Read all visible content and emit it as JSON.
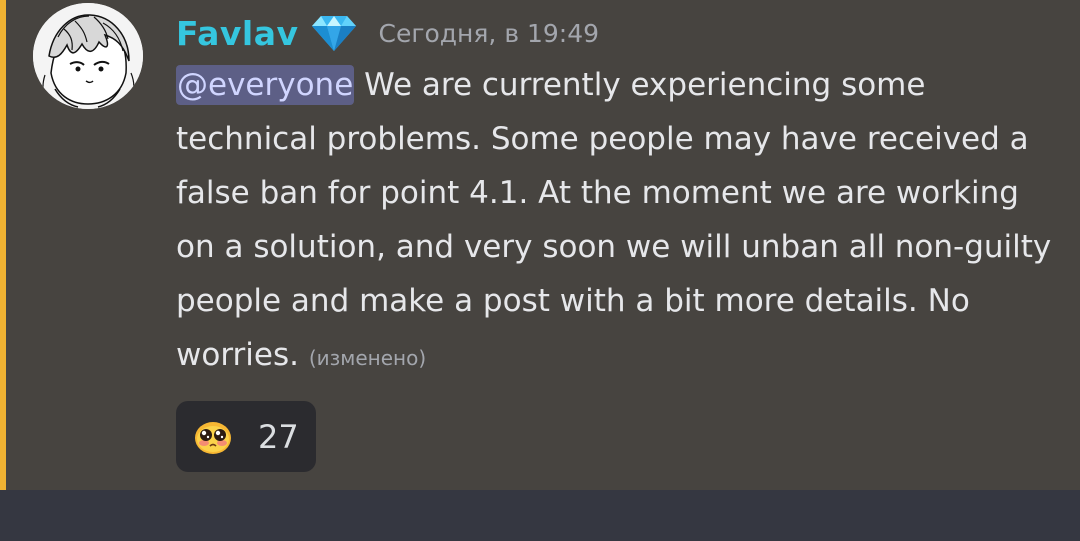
{
  "message": {
    "username": "Favlav",
    "badge_icon": "diamond-icon",
    "timestamp": "Сегодня, в 19:49",
    "mention": "@everyone",
    "text": " We are currently experiencing some technical problems. Some people may have received a false ban for point 4.1. At the moment we are working on a solution, and very soon we will unban all non-guilty people and make a post with a bit more details. No worries.",
    "edited_label": "(изменено)",
    "avatar_icon": "anime-avatar"
  },
  "reaction": {
    "emoji": "pleading-face-icon",
    "count": "27"
  },
  "colors": {
    "username": "#35c6df",
    "mention_bar": "#f0b232",
    "message_bg": "#474440",
    "page_bg": "#353741",
    "mention_bg": "#5d5f86",
    "reaction_bg": "#2b2b2f"
  }
}
